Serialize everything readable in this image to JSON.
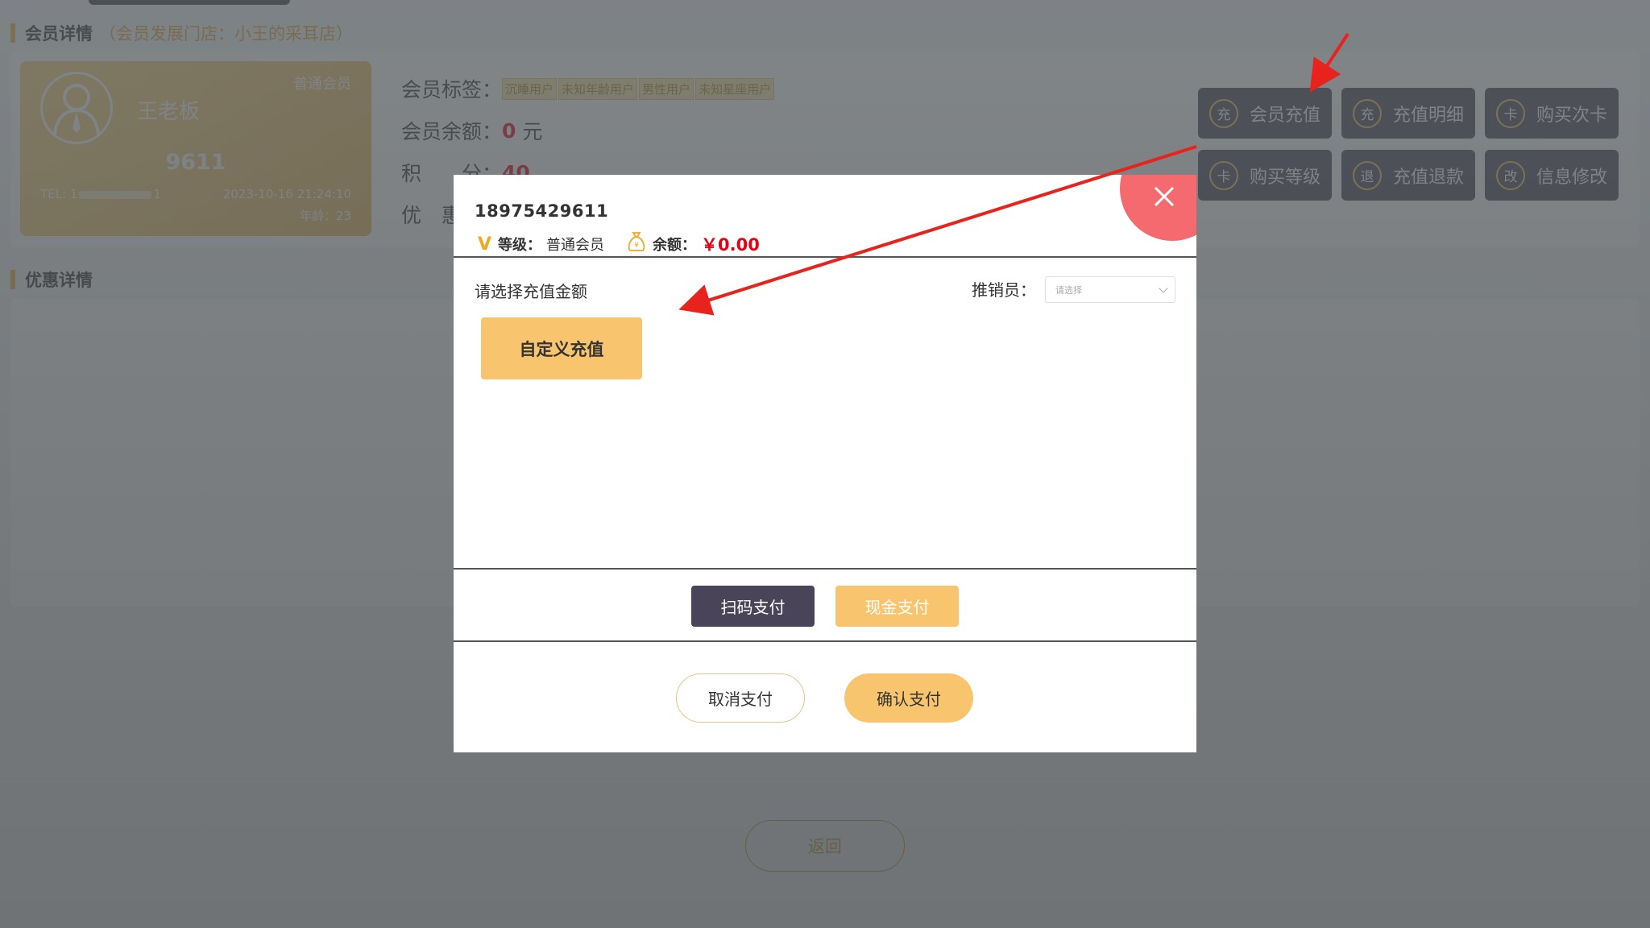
{
  "member_header": {
    "title": "会员详情",
    "store_note": "（会员发展门店：小王的采耳店）"
  },
  "member_card": {
    "name": "王老板",
    "level": "普通会员",
    "number": "9611",
    "tel_prefix": "TEL: 1",
    "tel_suffix": "1",
    "register_time": "2023-10-16 21:24:10",
    "age": "年龄：23"
  },
  "member_info": {
    "tags_label": "会员标签：",
    "tags": [
      "沉睡用户",
      "未知年龄用户",
      "男性用户",
      "未知星座用户"
    ],
    "balance_label": "会员余额：",
    "balance_value": "0",
    "balance_unit": "元",
    "points_label": "积　　分：",
    "points_value": "40",
    "discount_label": "优　惠"
  },
  "actions": [
    {
      "icon_char": "充",
      "label": "会员充值"
    },
    {
      "icon_char": "充",
      "label": "充值明细"
    },
    {
      "icon_char": "卡",
      "label": "购买次卡"
    },
    {
      "icon_char": "卡",
      "label": "购买等级"
    },
    {
      "icon_char": "退",
      "label": "充值退款"
    },
    {
      "icon_char": "改",
      "label": "信息修改"
    }
  ],
  "discount_header": {
    "title": "优惠详情"
  },
  "back_button": "返回",
  "modal": {
    "phone": "18975429611",
    "level_icon": "V",
    "level_label": "等级：",
    "level_value": "普通会员",
    "balance_label": "余额：",
    "balance_value": "￥0.00",
    "select_amount_label": "请选择充值金额",
    "salesperson_label": "推销员：",
    "salesperson_placeholder": "请选择",
    "custom_recharge_button": "自定义充值",
    "scan_pay_button": "扫码支付",
    "cash_pay_button": "现金支付",
    "cancel_button": "取消支付",
    "confirm_button": "确认支付"
  },
  "colors": {
    "accent": "#f8c56e",
    "dark_button": "#4a4458",
    "close": "#f46a6f",
    "price_red": "#e60012"
  }
}
